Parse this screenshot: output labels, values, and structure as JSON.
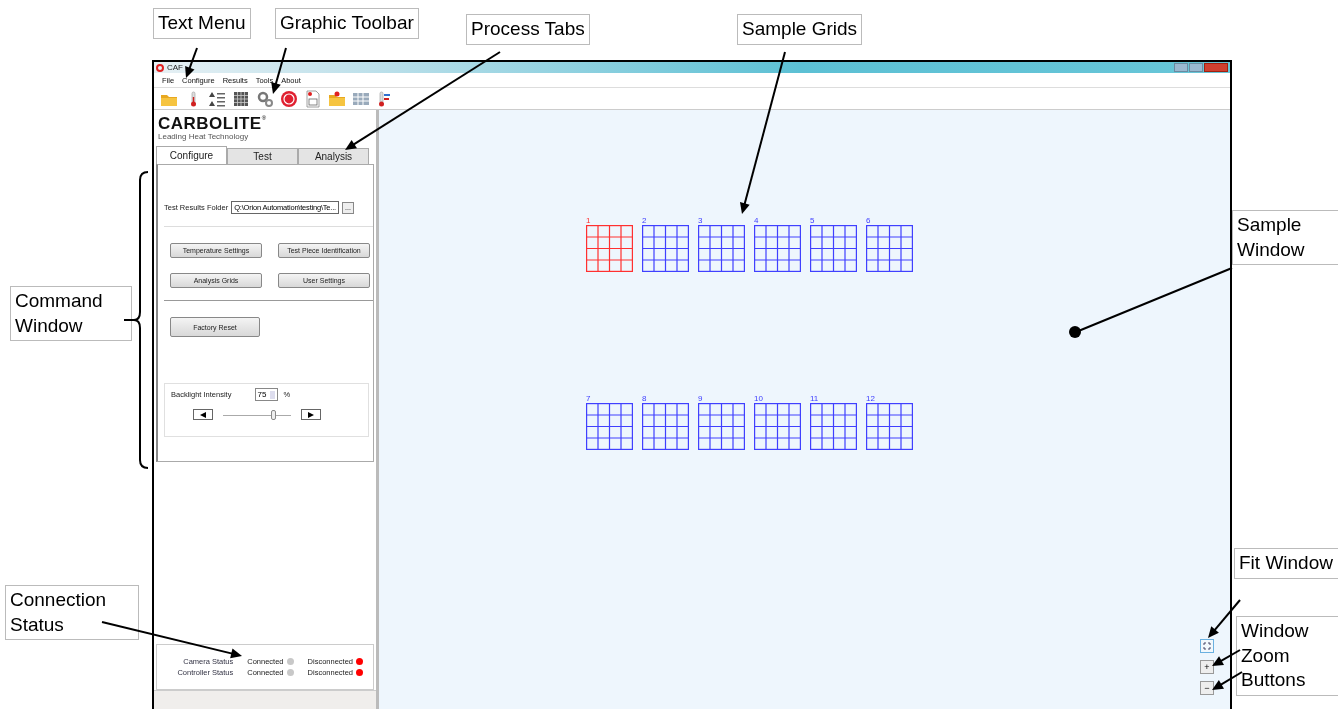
{
  "window": {
    "title": "CAF"
  },
  "menu": [
    "File",
    "Configure",
    "Results",
    "Tools",
    "About"
  ],
  "toolbar": [
    {
      "kind": "folder"
    },
    {
      "kind": "thermometer"
    },
    {
      "kind": "sort"
    },
    {
      "kind": "grid"
    },
    {
      "kind": "gears"
    },
    {
      "kind": "stop"
    },
    {
      "kind": "document"
    },
    {
      "kind": "folder-pin"
    },
    {
      "kind": "table"
    },
    {
      "kind": "thermo-flag"
    }
  ],
  "logo": {
    "brand": "CARBOLITE",
    "registered": "®",
    "tagline": "Leading Heat Technology"
  },
  "tabs": [
    {
      "label": "Configure",
      "selected": true
    },
    {
      "label": "Test",
      "selected": false
    },
    {
      "label": "Analysis",
      "selected": false
    }
  ],
  "command": {
    "folder_label": "Test Results Folder",
    "folder_value": "Q:\\Orion Automation\\testing\\Te...",
    "browse": "...",
    "buttons": [
      "Temperature Settings",
      "Test Piece Identification",
      "Analysis Grids",
      "User Settings"
    ],
    "reset": "Factory Reset",
    "backlight": {
      "label": "Backlight Intensity",
      "value": "75",
      "unit": "%",
      "level": 0.74
    }
  },
  "status": [
    {
      "label": "Camera Status",
      "indicators": [
        {
          "label": "Connected",
          "on": false
        },
        {
          "label": "Disconnected",
          "on": true
        }
      ]
    },
    {
      "label": "Controller Status",
      "indicators": [
        {
          "label": "Connected",
          "on": false
        },
        {
          "label": "Disconnected",
          "on": true
        }
      ]
    }
  ],
  "grids": [
    {
      "label": "1",
      "selected": true
    },
    {
      "label": "2",
      "selected": false
    },
    {
      "label": "3",
      "selected": false
    },
    {
      "label": "4",
      "selected": false
    },
    {
      "label": "5",
      "selected": false
    },
    {
      "label": "6",
      "selected": false
    },
    {
      "label": "7",
      "selected": false
    },
    {
      "label": "8",
      "selected": false
    },
    {
      "label": "9",
      "selected": false
    },
    {
      "label": "10",
      "selected": false
    },
    {
      "label": "11",
      "selected": false
    },
    {
      "label": "12",
      "selected": false
    }
  ],
  "zoom_buttons": [
    "+",
    "−"
  ],
  "annotations": [
    "Text Menu",
    "Graphic Toolbar",
    "Process Tabs",
    "Sample Grids",
    "Sample Window",
    "Command Window",
    "Connection Status",
    "Fit Window",
    "Window Zoom Buttons"
  ]
}
